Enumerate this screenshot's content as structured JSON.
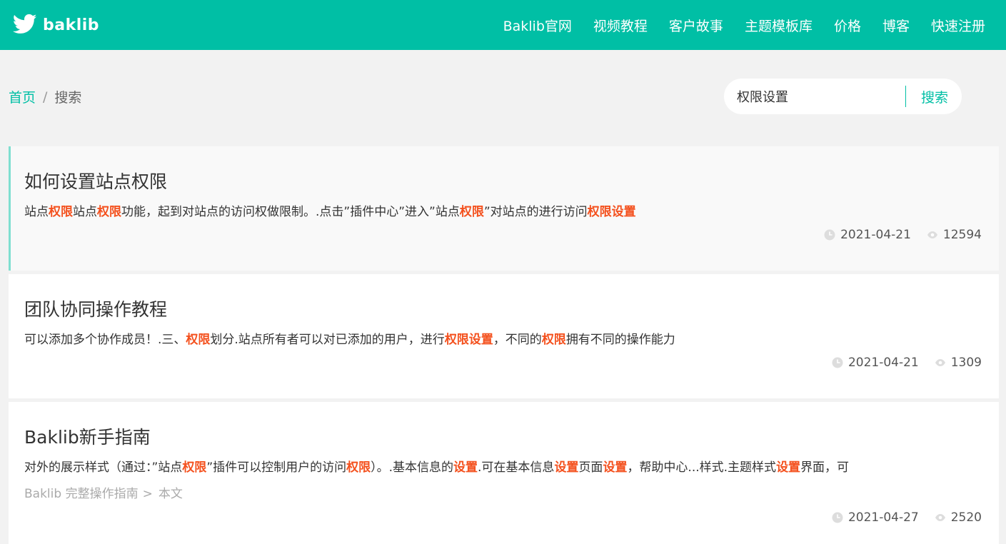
{
  "header": {
    "logo_text": "baklib",
    "nav": [
      "Baklib官网",
      "视频教程",
      "客户故事",
      "主题模板库",
      "价格",
      "博客",
      "快速注册"
    ]
  },
  "breadcrumb": {
    "home": "首页",
    "separator": "/",
    "current": "搜索"
  },
  "search": {
    "query": "权限设置",
    "button": "搜索"
  },
  "results": [
    {
      "title": "如何设置站点权限",
      "snippet": [
        {
          "t": "站点"
        },
        {
          "t": "权限",
          "hl": true
        },
        {
          "t": "站点"
        },
        {
          "t": "权限",
          "hl": true
        },
        {
          "t": "功能，起到对站点的访问权做限制。.点击”插件中心”进入”站点"
        },
        {
          "t": "权限",
          "hl": true
        },
        {
          "t": "”对站点的进行访问"
        },
        {
          "t": "权限设置",
          "hl": true
        }
      ],
      "date": "2021-04-21",
      "views": "12594"
    },
    {
      "title": "团队协同操作教程",
      "snippet": [
        {
          "t": "可以添加多个协作成员！.三、"
        },
        {
          "t": "权限",
          "hl": true
        },
        {
          "t": "划分.站点所有者可以对已添加的用户，进行"
        },
        {
          "t": "权限设置",
          "hl": true
        },
        {
          "t": "，不同的"
        },
        {
          "t": "权限",
          "hl": true
        },
        {
          "t": "拥有不同的操作能力"
        }
      ],
      "date": "2021-04-21",
      "views": "1309"
    },
    {
      "title": "Baklib新手指南",
      "snippet": [
        {
          "t": "对外的展示样式（通过：”站点"
        },
        {
          "t": "权限",
          "hl": true
        },
        {
          "t": "”插件可以控制用户的访问"
        },
        {
          "t": "权限",
          "hl": true
        },
        {
          "t": "）。.基本信息的"
        },
        {
          "t": "设置",
          "hl": true
        },
        {
          "t": ".可在基本信息"
        },
        {
          "t": "设置",
          "hl": true
        },
        {
          "t": "页面"
        },
        {
          "t": "设置",
          "hl": true
        },
        {
          "t": "，帮助中心...样式.主题样式"
        },
        {
          "t": "设置",
          "hl": true
        },
        {
          "t": "界面，可"
        }
      ],
      "path": {
        "parent": "Baklib 完整操作指南",
        "gt": ">",
        "current": "本文"
      },
      "date": "2021-04-27",
      "views": "2520"
    }
  ],
  "colors": {
    "brand": "#00bfa5",
    "highlight": "#f4511e",
    "accent_border": "#7fdfd0"
  },
  "icons": {
    "logo": "bird-icon",
    "date": "clock-icon",
    "views": "eye-icon"
  }
}
